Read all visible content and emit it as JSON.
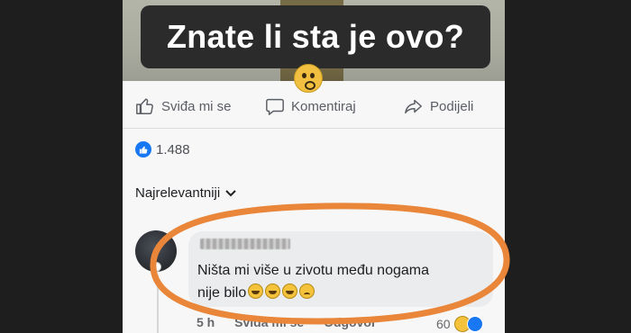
{
  "post": {
    "caption": "Znate li sta je ovo?"
  },
  "actions": {
    "like_label": "Sviđa mi se",
    "comment_label": "Komentiraj",
    "share_label": "Podijeli"
  },
  "reactions": {
    "count": "1.488"
  },
  "comments": {
    "sort_label": "Najrelevantniji",
    "items": [
      {
        "author": "████ ████",
        "line1": "Ništa mi više u zivotu među nogama",
        "line2": "nije bilo",
        "time": "5 h",
        "like_label": "Sviđa mi se",
        "reply_label": "Odgovor",
        "reaction_count": "60"
      }
    ]
  },
  "colors": {
    "accent": "#1877f2",
    "highlight": "#e9863a"
  }
}
